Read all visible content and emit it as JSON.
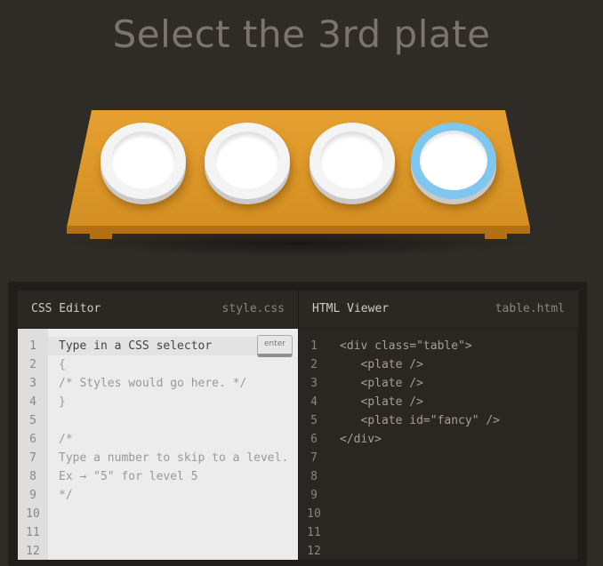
{
  "title": "Select the 3rd plate",
  "table": {
    "plates": [
      {
        "name": "plate-1",
        "fancy": false
      },
      {
        "name": "plate-2",
        "fancy": false
      },
      {
        "name": "plate-3",
        "fancy": false
      },
      {
        "name": "plate-fancy",
        "fancy": true
      }
    ]
  },
  "css_editor": {
    "title": "CSS Editor",
    "file": "style.css",
    "input_placeholder": "Type in a CSS selector",
    "enter_label": "enter",
    "line_numbers": [
      "1",
      "2",
      "3",
      "4",
      "5",
      "6",
      "7",
      "8",
      "9",
      "10",
      "11",
      "12"
    ],
    "lines": [
      "{",
      "/* Styles would go here. */",
      "}",
      "",
      "/*",
      "Type a number to skip to a level.",
      "Ex → \"5\" for level 5",
      "*/"
    ]
  },
  "html_viewer": {
    "title": "HTML Viewer",
    "file": "table.html",
    "line_numbers": [
      "1",
      "2",
      "3",
      "4",
      "5",
      "6",
      "7",
      "8",
      "9",
      "10",
      "11",
      "12"
    ],
    "lines": [
      "<div class=\"table\">",
      "   <plate />",
      "   <plate />",
      "   <plate />",
      "   <plate id=\"fancy\" />",
      "</div>"
    ]
  },
  "colors": {
    "background": "#2f2b27",
    "table": "#e5a030",
    "fancy_plate_rim": "#7ec8ef"
  }
}
